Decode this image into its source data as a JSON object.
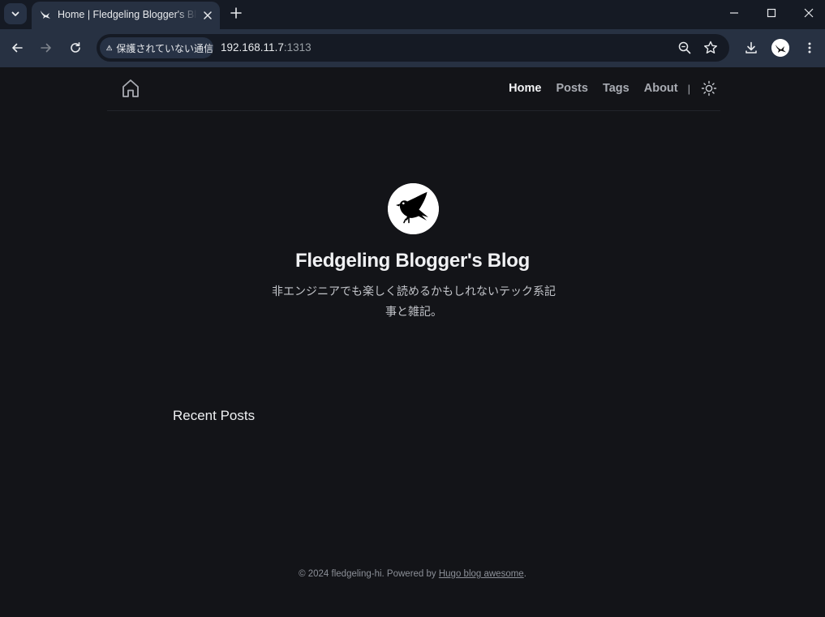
{
  "browser": {
    "tab": {
      "title": "Home | Fledgeling Blogger's Blog"
    },
    "security_label": "保護されていない通信",
    "url_host": "192.168.11.7",
    "url_port": ":1313"
  },
  "header": {
    "nav": [
      {
        "label": "Home",
        "active": true
      },
      {
        "label": "Posts",
        "active": false
      },
      {
        "label": "Tags",
        "active": false
      },
      {
        "label": "About",
        "active": false
      }
    ],
    "separator": "|"
  },
  "hero": {
    "title": "Fledgeling Blogger's Blog",
    "description": "非エンジニアでも楽しく読めるかもしれないテック系記事と雑記。"
  },
  "main": {
    "recent_posts_heading": "Recent Posts"
  },
  "footer": {
    "prefix": "© 2024 fledgeling-hi. Powered by ",
    "link_text": "Hugo blog awesome",
    "suffix": "."
  }
}
